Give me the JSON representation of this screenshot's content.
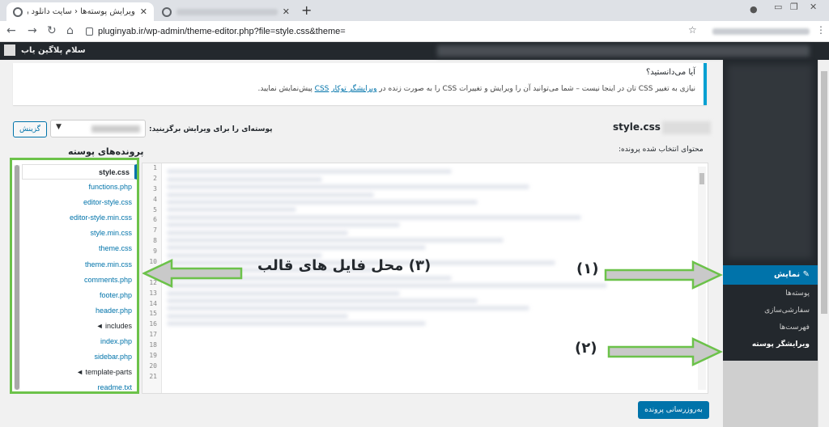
{
  "browser": {
    "active_tab_title": "ویرایش پوسته‌ها ‹ سایت دانلود رایگان افزو…",
    "url": "pluginyab.ir/wp-admin/theme-editor.php?file=style.css&theme=",
    "new_tab": "+"
  },
  "admin_bar": {
    "site_name": "سلام پلاگین یاب"
  },
  "notice": {
    "question": "آیا می‌دانستید؟",
    "text_before": "نیازی به تغییر CSS تان در اینجا نیست – شما می‌توانید آن را ویرایش و تغییرات CSS را به صورت زنده در ",
    "link1": "ویرایشگر توکار",
    "space": " ",
    "link2": "CSS",
    "text_after": " پیش‌نمایش نمایید."
  },
  "editor": {
    "file_title": "style.css",
    "select_label": "پوسته‌ای را برای ویرایش برگزینید:",
    "select_button": "گزینش",
    "content_label": "محتوای انتخاب شده پرونده:",
    "files_heading": "پرونده‌های پوسته",
    "update_button": "به‌روزرسانی پرونده",
    "line_numbers": [
      "1",
      "2",
      "3",
      "4",
      "5",
      "6",
      "7",
      "8",
      "9",
      "10",
      "11",
      "12",
      "13",
      "14",
      "15",
      "16",
      "17",
      "18",
      "19",
      "20",
      "21"
    ]
  },
  "files": [
    {
      "name": "style.css",
      "active": true
    },
    {
      "name": "functions.php"
    },
    {
      "name": "editor-style.css"
    },
    {
      "name": "editor-style.min.css"
    },
    {
      "name": "style.min.css"
    },
    {
      "name": "theme.css"
    },
    {
      "name": "theme.min.css"
    },
    {
      "name": "comments.php"
    },
    {
      "name": "footer.php"
    },
    {
      "name": "header.php"
    },
    {
      "name": "◄ includes",
      "folder": true
    },
    {
      "name": "index.php"
    },
    {
      "name": "sidebar.php"
    },
    {
      "name": "◄ template-parts",
      "folder": true
    },
    {
      "name": "readme.txt"
    }
  ],
  "sidebar": {
    "appearance": "نمایش",
    "submenu": [
      "پوسته‌ها",
      "سفارشی‌سازی",
      "فهرست‌ها",
      "ویرایشگر پوسته"
    ]
  },
  "annotations": {
    "one": "(۱)",
    "two": "(۲)",
    "three": "(۳) محل فایل های قالب",
    "color": "#6cc24a"
  }
}
